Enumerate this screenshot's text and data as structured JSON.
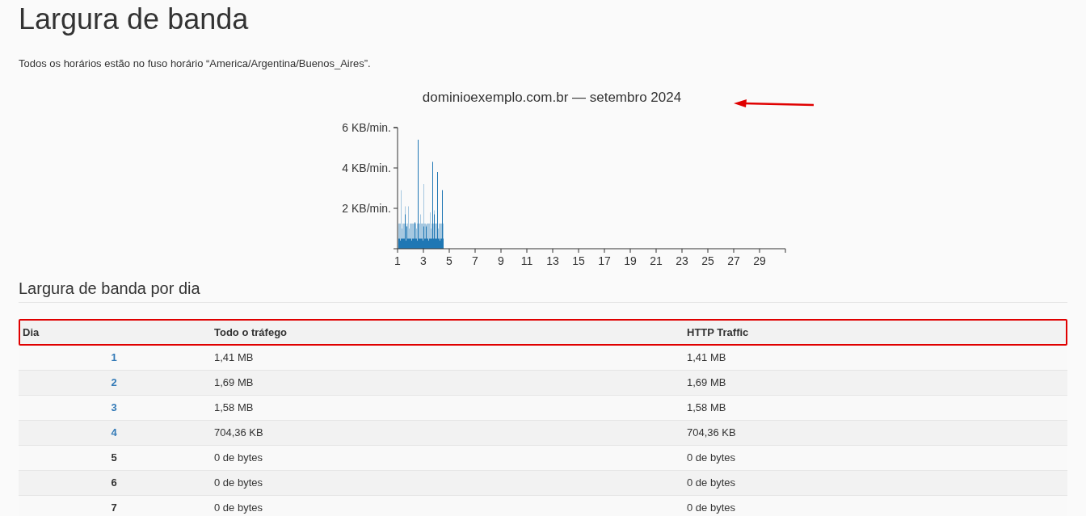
{
  "page": {
    "title": "Largura de banda",
    "timezone_note": "Todos os horários estão no fuso horário “America/Argentina/Buenos_Aires”."
  },
  "chart": {
    "title": "dominioexemplo.com.br — setembro 2024",
    "y_tick_labels": [
      "6 KB/min.",
      "4 KB/min.",
      "2 KB/min."
    ],
    "x_tick_labels": [
      "1",
      "3",
      "5",
      "7",
      "9",
      "11",
      "13",
      "15",
      "17",
      "19",
      "21",
      "23",
      "25",
      "27",
      "29"
    ]
  },
  "section": {
    "title": "Largura de banda por dia"
  },
  "table": {
    "columns": [
      "Dia",
      "Todo o tráfego",
      "HTTP Traffic"
    ],
    "rows": [
      {
        "day": "1",
        "link": true,
        "all": "1,41 MB",
        "http": "1,41 MB"
      },
      {
        "day": "2",
        "link": true,
        "all": "1,69 MB",
        "http": "1,69 MB"
      },
      {
        "day": "3",
        "link": true,
        "all": "1,58 MB",
        "http": "1,58 MB"
      },
      {
        "day": "4",
        "link": true,
        "all": "704,36 KB",
        "http": "704,36 KB"
      },
      {
        "day": "5",
        "link": false,
        "all": "0 de bytes",
        "http": "0 de bytes"
      },
      {
        "day": "6",
        "link": false,
        "all": "0 de bytes",
        "http": "0 de bytes"
      },
      {
        "day": "7",
        "link": false,
        "all": "0 de bytes",
        "http": "0 de bytes"
      }
    ]
  }
}
